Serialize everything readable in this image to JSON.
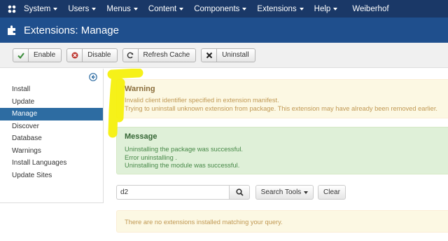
{
  "navbar": {
    "logo_icon": "joomla-logo-icon",
    "menus": [
      {
        "label": "System"
      },
      {
        "label": "Users"
      },
      {
        "label": "Menus"
      },
      {
        "label": "Content"
      },
      {
        "label": "Components"
      },
      {
        "label": "Extensions"
      },
      {
        "label": "Help"
      }
    ],
    "site": "Weiberhof"
  },
  "header": {
    "icon": "puzzle-piece-icon",
    "title": "Extensions: Manage"
  },
  "toolbar": {
    "enable_label": "Enable",
    "disable_label": "Disable",
    "refresh_label": "Refresh Cache",
    "uninstall_label": "Uninstall"
  },
  "sidebar": {
    "items": [
      {
        "label": "Install"
      },
      {
        "label": "Update"
      },
      {
        "label": "Manage",
        "active": true
      },
      {
        "label": "Discover"
      },
      {
        "label": "Database"
      },
      {
        "label": "Warnings"
      },
      {
        "label": "Install Languages"
      },
      {
        "label": "Update Sites"
      }
    ]
  },
  "warning": {
    "heading": "Warning",
    "lines": [
      "Invalid client identifier specified in extension manifest.",
      "Trying to uninstall unknown extension from package. This extension may have already been removed earlier."
    ]
  },
  "message": {
    "heading": "Message",
    "lines": [
      "Uninstalling the package was successful.",
      "Error uninstalling .",
      "Uninstalling the module was successful."
    ]
  },
  "search": {
    "value": "d2",
    "tools_label": "Search Tools",
    "clear_label": "Clear"
  },
  "no_results": "There are no extensions installed matching your query.",
  "colors": {
    "navbar": "#1a3867",
    "header": "#1f4f8d",
    "active": "#2d6ca2",
    "highlighter": "#f5ef00"
  }
}
